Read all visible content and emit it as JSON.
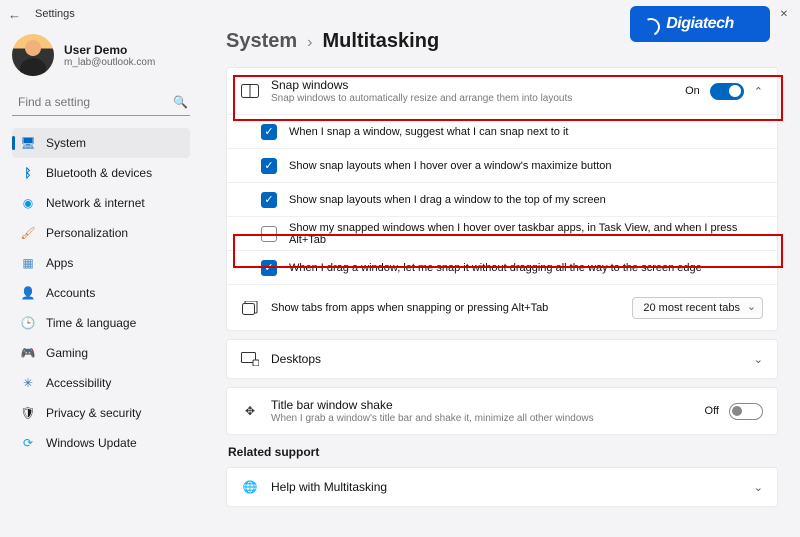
{
  "window": {
    "title": "Settings"
  },
  "user": {
    "name": "User Demo",
    "email": "m_lab@outlook.com"
  },
  "search": {
    "placeholder": "Find a setting"
  },
  "sidebar": {
    "items": [
      {
        "label": "System",
        "icon": "🖥",
        "color": "#0067c0"
      },
      {
        "label": "Bluetooth & devices",
        "icon": "B",
        "color": "#0078d4"
      },
      {
        "label": "Network & internet",
        "icon": "📶",
        "color": "#0099e5"
      },
      {
        "label": "Personalization",
        "icon": "🖌",
        "color": "#d77a2e"
      },
      {
        "label": "Apps",
        "icon": "▦",
        "color": "#4a88c7"
      },
      {
        "label": "Accounts",
        "icon": "👤",
        "color": "#4a7a8a"
      },
      {
        "label": "Time & language",
        "icon": "🕒",
        "color": "#555"
      },
      {
        "label": "Gaming",
        "icon": "🎮",
        "color": "#555"
      },
      {
        "label": "Accessibility",
        "icon": "✳",
        "color": "#3a6ea5"
      },
      {
        "label": "Privacy & security",
        "icon": "🛡",
        "color": "#555"
      },
      {
        "label": "Windows Update",
        "icon": "🔄",
        "color": "#0aa3e0"
      }
    ]
  },
  "breadcrumb": {
    "parent": "System",
    "current": "Multitasking"
  },
  "snap": {
    "title": "Snap windows",
    "desc": "Snap windows to automatically resize and arrange them into layouts",
    "state_label": "On",
    "options": [
      {
        "checked": true,
        "label": "When I snap a window, suggest what I can snap next to it"
      },
      {
        "checked": true,
        "label": "Show snap layouts when I hover over a window's maximize button"
      },
      {
        "checked": true,
        "label": "Show snap layouts when I drag a window to the top of my screen"
      },
      {
        "checked": false,
        "label": "Show my snapped windows when I hover over taskbar apps, in Task View, and when I press Alt+Tab"
      },
      {
        "checked": true,
        "label": "When I drag a window, let me snap it without dragging all the way to the screen edge"
      }
    ]
  },
  "tabs": {
    "label": "Show tabs from apps when snapping or pressing Alt+Tab",
    "value": "20 most recent tabs"
  },
  "desktops": {
    "label": "Desktops"
  },
  "shake": {
    "title": "Title bar window shake",
    "desc": "When I grab a window's title bar and shake it, minimize all other windows",
    "state_label": "Off"
  },
  "related": {
    "heading": "Related support",
    "help": "Help with Multitasking"
  },
  "brand": {
    "name": "Digiatech"
  }
}
